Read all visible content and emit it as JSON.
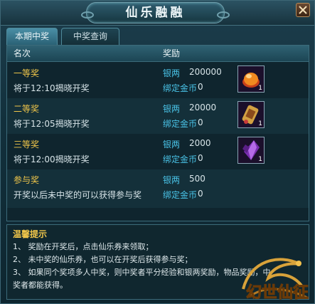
{
  "window": {
    "title": "仙乐融融",
    "close_icon": "close-icon"
  },
  "tabs": [
    {
      "label": "本期中奖",
      "active": true
    },
    {
      "label": "中奖查询",
      "active": false
    }
  ],
  "table": {
    "columns": [
      "名次",
      "奖励"
    ],
    "rows": [
      {
        "name": "一等奖",
        "draw_time": "将于12:10揭晓开奖",
        "silver_label": "银两",
        "silver_value": "200000",
        "gold_label": "绑定金币",
        "gold_value": "0",
        "item_icon": "amber-fruit-icon",
        "item_count": "1"
      },
      {
        "name": "二等奖",
        "draw_time": "将于12:05揭晓开奖",
        "silver_label": "银两",
        "silver_value": "20000",
        "gold_label": "绑定金币",
        "gold_value": "0",
        "item_icon": "gold-talisman-icon",
        "item_count": "1"
      },
      {
        "name": "三等奖",
        "draw_time": "将于12:00揭晓开奖",
        "silver_label": "银两",
        "silver_value": "2000",
        "gold_label": "绑定金币",
        "gold_value": "0",
        "item_icon": "purple-crystal-icon",
        "item_count": "1"
      },
      {
        "name": "参与奖",
        "draw_time": "开奖以后未中奖的可以获得参与奖",
        "silver_label": "银两",
        "silver_value": "500",
        "gold_label": "绑定金币",
        "gold_value": "0"
      }
    ]
  },
  "tips": {
    "title": "温馨提示",
    "lines": [
      "1、  奖励在开奖后，点击仙乐券来领取；",
      "2、  未中奖的仙乐券，也可以在开奖后获得参与奖；",
      "3、  如果同个奖项多人中奖，则中奖者平分经验和银两奖励，物品奖励，中",
      "奖者都能获得。"
    ]
  },
  "logo": {
    "text": "幻世仙征",
    "icon": "dragon-logo-icon"
  },
  "colors": {
    "prize_name": "#f0c64a",
    "reward_label": "#49c2e6",
    "text": "#d7e4e8"
  }
}
